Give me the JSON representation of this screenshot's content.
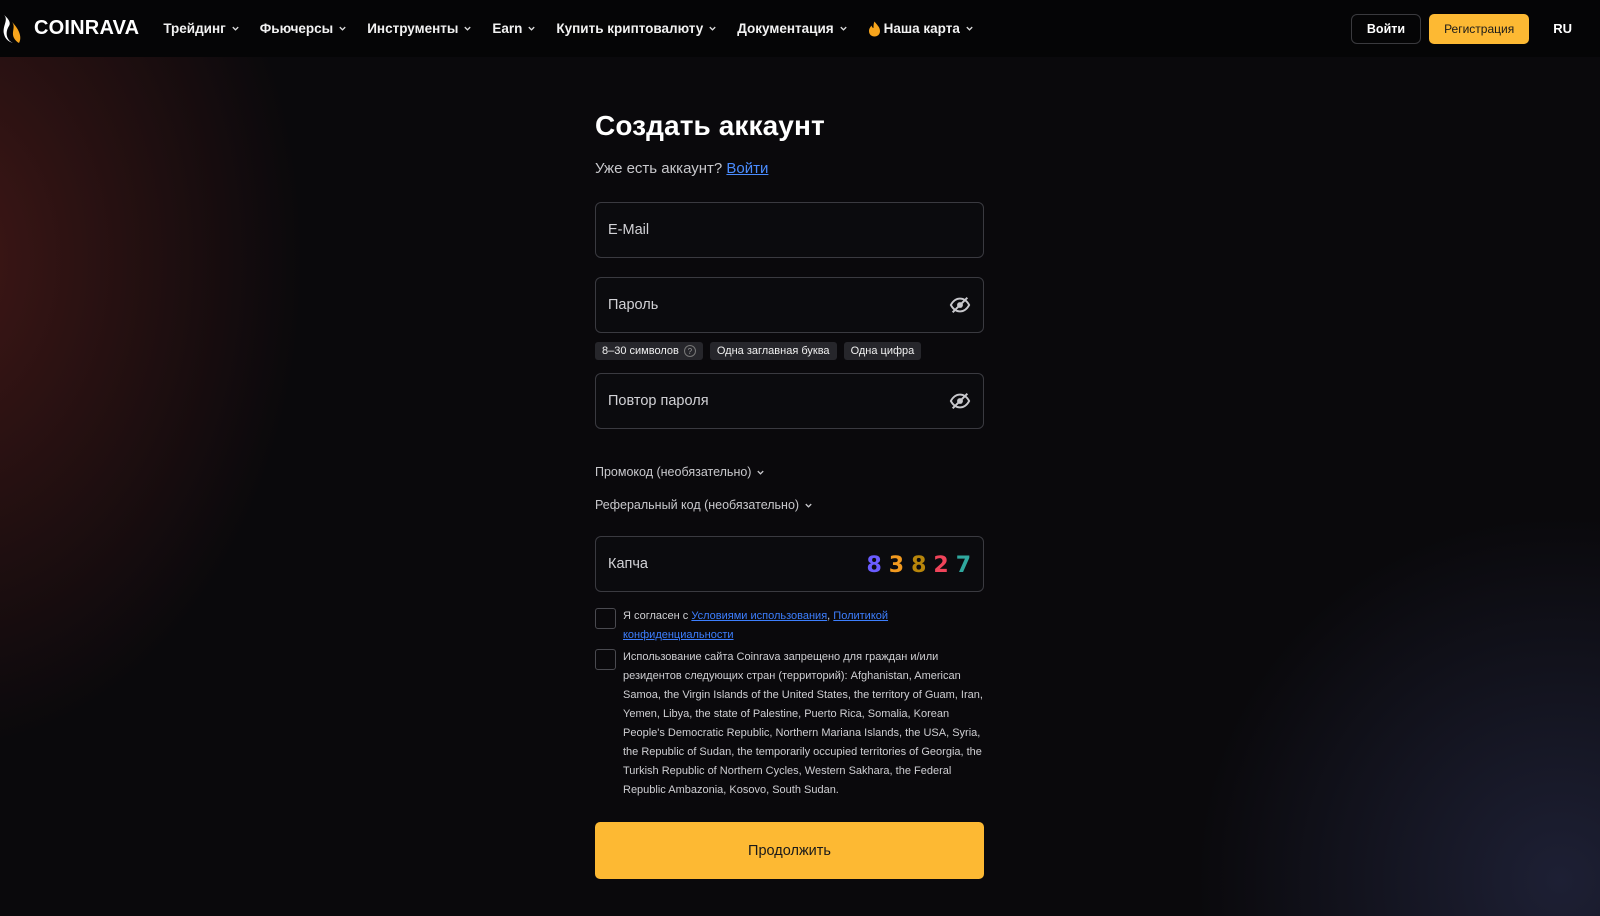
{
  "header": {
    "brand": "COINRAVA",
    "nav": [
      {
        "label": "Трейдинг"
      },
      {
        "label": "Фьючерсы"
      },
      {
        "label": "Инструменты"
      },
      {
        "label": "Earn"
      },
      {
        "label": "Купить криптовалюту"
      },
      {
        "label": "Документация"
      },
      {
        "label": "Наша карта"
      }
    ],
    "login": "Войти",
    "register": "Регистрация",
    "lang": "RU"
  },
  "form": {
    "title": "Создать аккаунт",
    "have_account": "Уже есть аккаунт?",
    "login_link": "Войти",
    "email_placeholder": "E-Mail",
    "password_placeholder": "Пароль",
    "hints": [
      "8–30 символов",
      "Одна заглавная буква",
      "Одна цифра"
    ],
    "hint_help": "?",
    "repeat_placeholder": "Повтор пароля",
    "promo_toggle": "Промокод (необязательно)",
    "referral_toggle": "Реферальный код (необязательно)",
    "captcha_placeholder": "Капча",
    "captcha_digits": [
      {
        "d": "8",
        "color": "#6a5cff"
      },
      {
        "d": "3",
        "color": "#f29a1f"
      },
      {
        "d": "8",
        "color": "#b8860b"
      },
      {
        "d": "2",
        "color": "#f0445a"
      },
      {
        "d": "7",
        "color": "#2fa89e"
      }
    ],
    "agree_prefix": "Я согласен с",
    "terms_link": "Условиями использования",
    "agree_sep": ",",
    "privacy_link": "Политикой конфиденциальности",
    "restriction_text": "Использование сайта Coinrava запрещено для граждан и/или резидентов следующих стран (территорий): Afghanistan, American Samoa, the Virgin Islands of the United States, the territory of Guam, Iran, Yemen, Libya, the state of Palestine, Puerto Rica, Somalia, Korean People's Democratic Republic, Northern Mariana Islands, the USA, Syria, the Republic of Sudan, the temporarily occupied territories of Georgia, the Turkish Republic of Northern Cycles, Western Sakhara, the Federal Republic Ambazonia, Kosovo, South Sudan.",
    "continue": "Продолжить"
  },
  "colors": {
    "accent": "#fdb933",
    "link": "#4a8cff",
    "background": "#0a090c"
  }
}
